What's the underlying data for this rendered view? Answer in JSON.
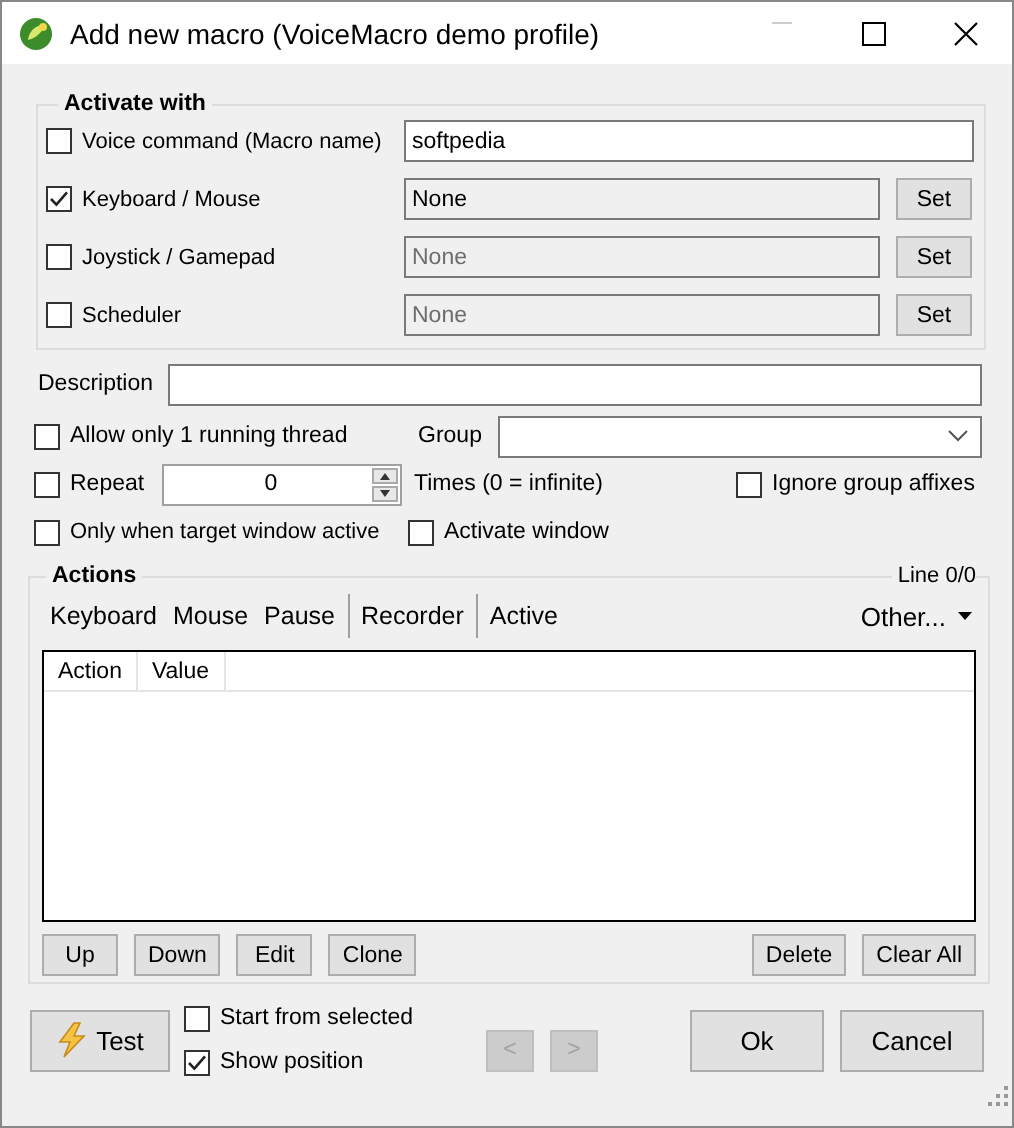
{
  "window": {
    "title": "Add new macro (VoiceMacro demo profile)"
  },
  "activate_with": {
    "title": "Activate with",
    "triggers": [
      {
        "kind": "text",
        "label": "Voice command (Macro name)",
        "checked": false,
        "value": "softpedia"
      },
      {
        "kind": "set",
        "label": "Keyboard / Mouse",
        "checked": true,
        "value": "None",
        "disabled": false,
        "button": "Set"
      },
      {
        "kind": "set",
        "label": "Joystick / Gamepad",
        "checked": false,
        "value": "None",
        "disabled": true,
        "button": "Set"
      },
      {
        "kind": "set",
        "label": "Scheduler",
        "checked": false,
        "value": "None",
        "disabled": true,
        "button": "Set"
      }
    ]
  },
  "description": {
    "label": "Description"
  },
  "options": {
    "single_thread": {
      "label": "Allow only 1 running thread",
      "checked": false
    },
    "group": {
      "label": "Group"
    },
    "repeat": {
      "label": "Repeat",
      "checked": false,
      "value": "0",
      "suffix": "Times (0 = infinite)"
    },
    "ignore_affixes": {
      "label": "Ignore group affixes",
      "checked": false
    },
    "target_window": {
      "label": "Only when target window active",
      "checked": false
    },
    "activate_window": {
      "label": "Activate window",
      "checked": false
    }
  },
  "actions": {
    "title": "Actions",
    "line": "Line 0/0",
    "toolbar": [
      {
        "kind": "item",
        "label": "Keyboard"
      },
      {
        "kind": "item",
        "label": "Mouse"
      },
      {
        "kind": "item",
        "label": "Pause"
      },
      {
        "kind": "separator"
      },
      {
        "kind": "item",
        "label": "Recorder"
      },
      {
        "kind": "separator"
      },
      {
        "kind": "item",
        "label": "Active"
      }
    ],
    "other": "Other...",
    "columns": [
      "Action",
      "Value"
    ],
    "left_buttons": [
      "Up",
      "Down",
      "Edit",
      "Clone"
    ],
    "right_buttons": [
      "Delete",
      "Clear All"
    ]
  },
  "footer": {
    "test": "Test",
    "start_from_selected": {
      "label": "Start from selected",
      "checked": false
    },
    "show_position": {
      "label": "Show position",
      "checked": true
    },
    "nav": [
      {
        "label": "<",
        "disabled": true
      },
      {
        "label": ">",
        "disabled": true
      }
    ],
    "ok": "Ok",
    "cancel": "Cancel"
  }
}
